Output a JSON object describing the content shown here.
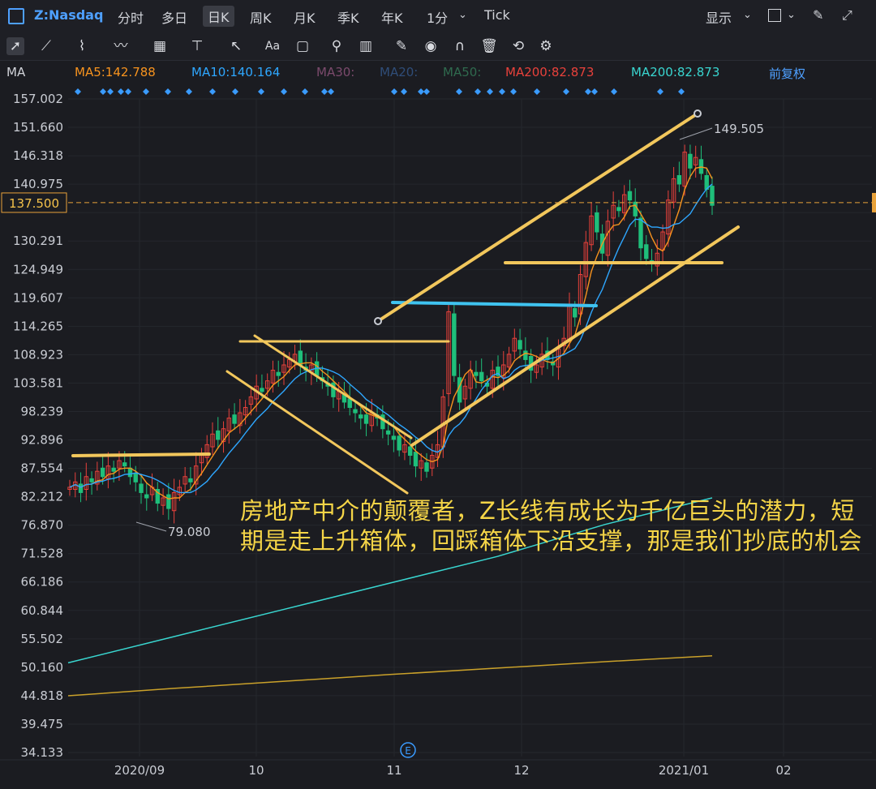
{
  "header": {
    "symbol": "Z:Nasdaq",
    "tabs": [
      "分时",
      "多日",
      "日K",
      "周K",
      "月K",
      "季K",
      "年K",
      "1分",
      "Tick"
    ],
    "active_tab": "日K",
    "display_label": "显示"
  },
  "ma_bar": {
    "ma_label": "MA",
    "ma5": "MA5:142.788",
    "ma10": "MA10:140.164",
    "ma30": "MA30:",
    "ma20": "MA20:",
    "ma50": "MA50:",
    "ma200a": "MA200:82.873",
    "ma200b": "MA200:82.873",
    "adjust": "前复权"
  },
  "price_marker": "137.500",
  "annotation_text": "房地产中介的颠覆者，Z长线有成长为千亿巨头的潜力，短期是走上升箱体，回踩箱体下沿支撑，那是我们抄底的机会",
  "colors": {
    "up": "#e8413b",
    "down": "#1fbf7a",
    "ma5": "#f7931e",
    "ma10": "#2ea7ff",
    "ma200_cyan": "#39d6d0",
    "ma200_gold": "#caa12a",
    "trendline": "#f2c75c",
    "blue_line": "#3fc3f0",
    "annotation": "#f5d547"
  },
  "chart_data": {
    "type": "candlestick",
    "title": "",
    "y_ticks": [
      "157.002",
      "151.660",
      "146.318",
      "140.975",
      "135.633",
      "130.291",
      "124.949",
      "119.607",
      "114.265",
      "108.923",
      "103.581",
      "98.239",
      "92.896",
      "87.554",
      "82.212",
      "76.870",
      "71.528",
      "66.186",
      "60.844",
      "55.502",
      "50.160",
      "44.818",
      "39.475",
      "34.133"
    ],
    "ylim": [
      34.133,
      157.002
    ],
    "x_ticks": [
      "2020/09",
      "10",
      "11",
      "12",
      "2021/01",
      "02"
    ],
    "high_label": "149.505",
    "low_label": "79.080",
    "event_marker": "E",
    "candles_close": [
      84,
      85,
      83,
      86,
      85,
      87,
      86,
      88,
      87,
      89,
      88,
      86,
      85,
      83,
      82,
      84,
      81,
      82,
      80,
      83,
      84,
      86,
      85,
      88,
      90,
      92,
      94,
      93,
      95,
      97,
      96,
      98,
      99,
      101,
      103,
      102,
      104,
      106,
      105,
      107,
      108,
      109,
      107,
      106,
      107,
      105,
      104,
      103,
      101,
      102,
      100,
      99,
      98,
      97,
      96,
      98,
      97,
      95,
      94,
      93,
      91,
      92,
      90,
      88,
      89,
      87,
      90,
      92,
      101,
      117,
      105,
      100,
      103,
      106,
      105,
      104,
      103,
      106,
      105,
      107,
      109,
      112,
      110,
      108,
      106,
      107,
      109,
      108,
      107,
      110,
      112,
      118,
      116,
      124,
      130,
      135,
      132,
      128,
      134,
      137,
      136,
      139,
      138,
      135,
      129,
      127,
      126,
      128,
      132,
      138,
      142,
      141,
      147,
      144,
      146,
      143,
      140,
      137
    ],
    "ma200_cyan": [
      51,
      56,
      61,
      66,
      71,
      77,
      82
    ],
    "ma200_gold": [
      44.8,
      46.2,
      47.5,
      48.8,
      50.0,
      51.2,
      52.3
    ]
  }
}
